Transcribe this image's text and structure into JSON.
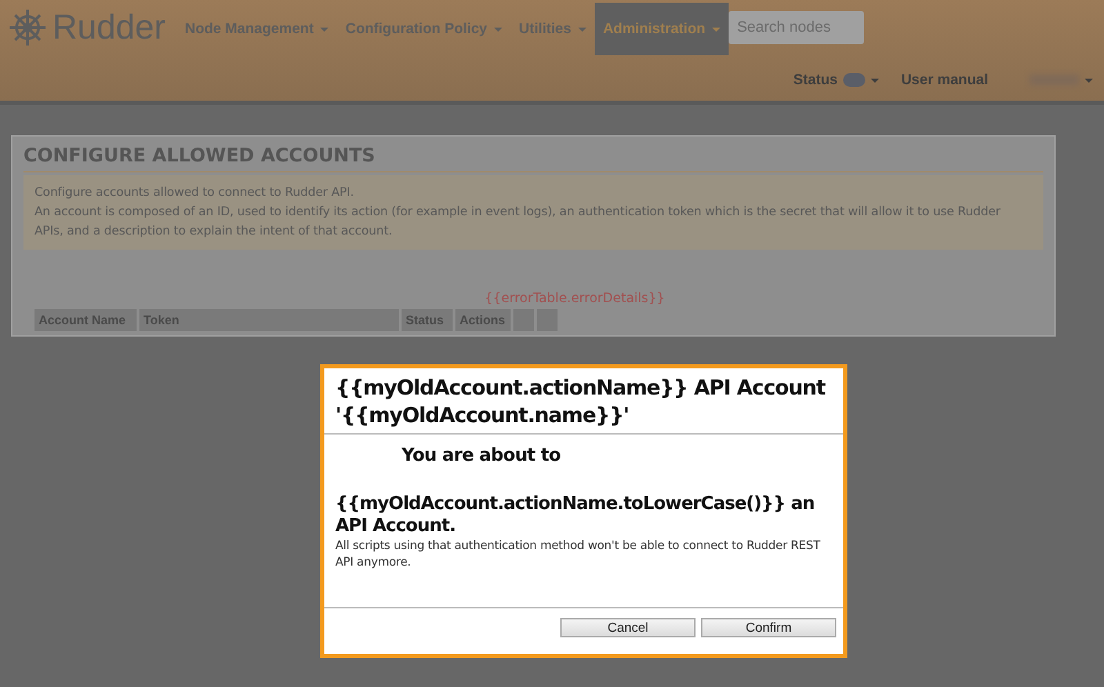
{
  "header": {
    "logo": "Rudder",
    "nav": [
      {
        "label": "Node Management",
        "selected": false
      },
      {
        "label": "Configuration Policy",
        "selected": false
      },
      {
        "label": "Utilities",
        "selected": false
      },
      {
        "label": "Administration",
        "selected": true
      }
    ],
    "search": {
      "placeholder": "Search nodes"
    },
    "status": "Status",
    "user_manual": "User manual"
  },
  "panel": {
    "title": "CONFIGURE ALLOWED ACCOUNTS",
    "description": [
      "Configure accounts allowed to connect to Rudder API.",
      "An account is composed of an ID, used to identify its action (for example in event logs), an authentication token which is the secret that will allow it to use Rudder APIs, and a description to explain the intent of that account."
    ],
    "error": "{{errorTable.errorDetails}}",
    "columns": [
      "Account Name",
      "Token",
      "Status",
      "Actions"
    ]
  },
  "dialog": {
    "title": "{{myOldAccount.actionName}} API Account '{{myOldAccount.name}}'",
    "lead": "You are about to",
    "action": "{{myOldAccount.actionName.toLowerCase()}} an API Account.",
    "note": "All scripts using that authentication method won't be able to connect to Rudder REST API anymore.",
    "buttons": [
      "Cancel",
      "Confirm"
    ]
  }
}
